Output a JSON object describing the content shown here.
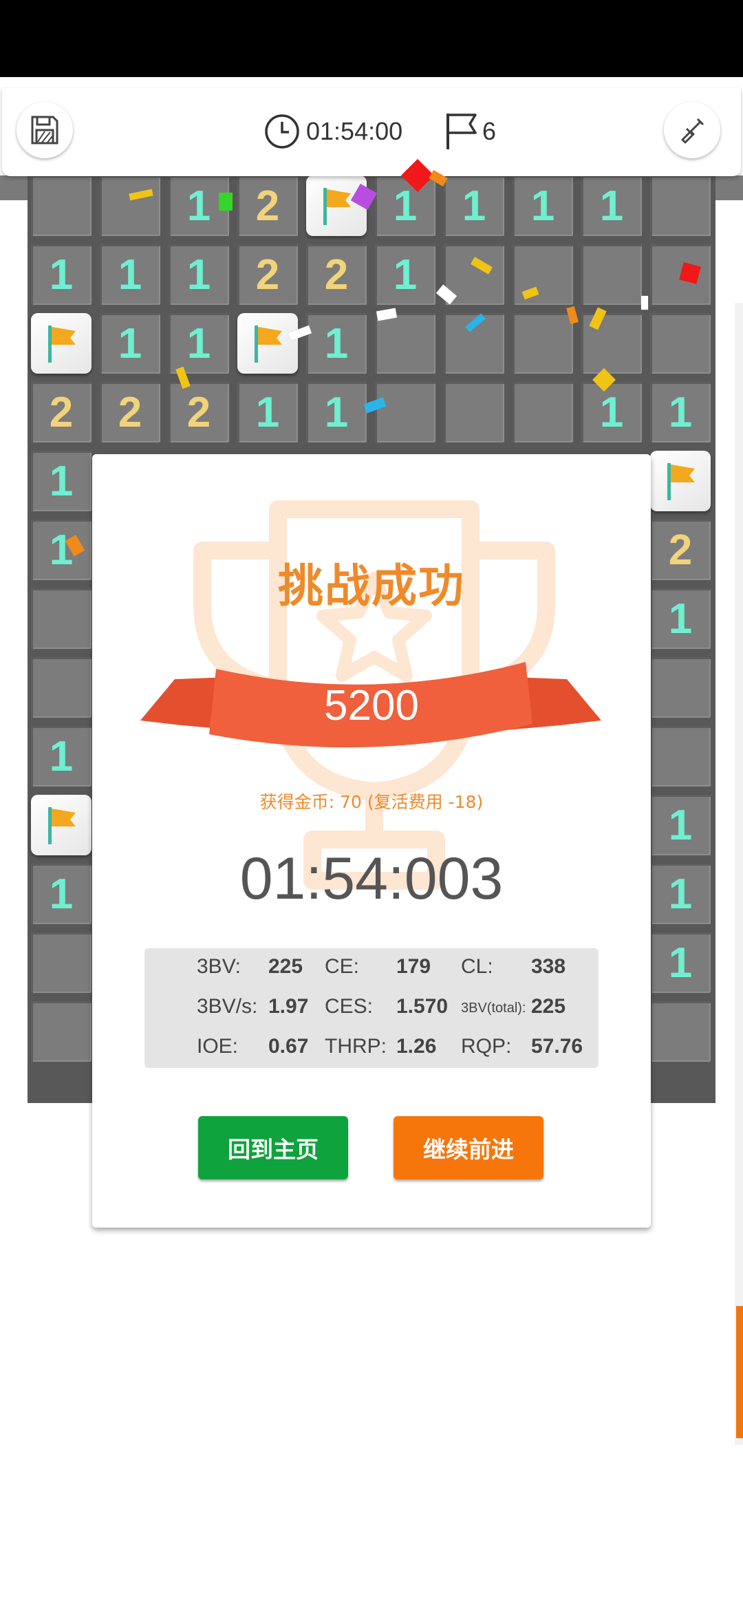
{
  "toolbar": {
    "save_icon": "save-icon",
    "timer_icon": "clock-icon",
    "timer": "01:54:00",
    "flag_icon": "flag-icon",
    "flag_count": "6",
    "shovel_icon": "shovel-icon"
  },
  "dialog": {
    "title": "挑战成功",
    "score": "5200",
    "coins_text": "获得金币: 70 (复活费用 -18)",
    "time": "01:54:003",
    "stats": {
      "bv_label": "3BV:",
      "bv": "225",
      "ce_label": "CE:",
      "ce": "179",
      "cl_label": "CL:",
      "cl": "338",
      "bvs_label": "3BV/s:",
      "bvs": "1.97",
      "ces_label": "CES:",
      "ces": "1.570",
      "bvtotal_label": "3BV(total):",
      "bvtotal": "225",
      "ioe_label": "IOE:",
      "ioe": "0.67",
      "thrp_label": "THRP:",
      "thrp": "1.26",
      "rqp_label": "RQP:",
      "rqp": "57.76"
    },
    "home_button": "回到主页",
    "continue_button": "继续前进"
  },
  "colors": {
    "accent_orange": "#f7760c",
    "success_green": "#0ea33c",
    "title_orange": "#ef8a2b",
    "ribbon_red": "#f0603c"
  }
}
